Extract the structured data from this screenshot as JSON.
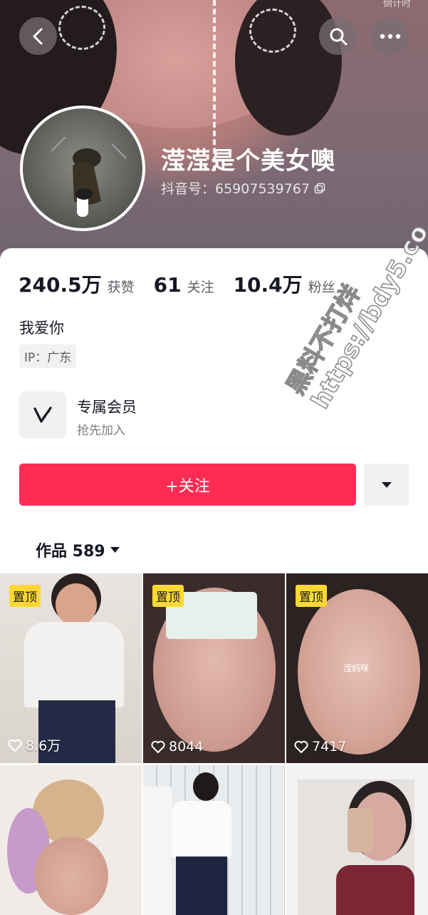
{
  "header": {
    "corner_text": "倒计时",
    "nickname": "滢滢是个美女噢",
    "douyin_id": "抖音号：65907539767"
  },
  "stats": [
    {
      "value": "240.5万",
      "label": "获赞"
    },
    {
      "value": "61",
      "label": "关注"
    },
    {
      "value": "10.4万",
      "label": "粉丝"
    }
  ],
  "profile": {
    "bio": "我爱你",
    "ip": "IP：广东"
  },
  "membership": {
    "title": "专属会员",
    "subtitle": "抢先加入"
  },
  "actions": {
    "follow_label": "+关注"
  },
  "works_tab": {
    "label": "作品 589"
  },
  "videos": [
    {
      "pinned_label": "置顶",
      "likes": "8.6万"
    },
    {
      "pinned_label": "置顶",
      "likes": "8044"
    },
    {
      "pinned_label": "置顶",
      "likes": "7417",
      "overlay_text": "滢妈咪"
    },
    {},
    {},
    {}
  ],
  "watermark": {
    "line1": "黑料不打烊",
    "line2": "https://bdy5.co"
  },
  "colors": {
    "follow_button": "#fe2c55",
    "pin_badge": "#fdd835"
  }
}
